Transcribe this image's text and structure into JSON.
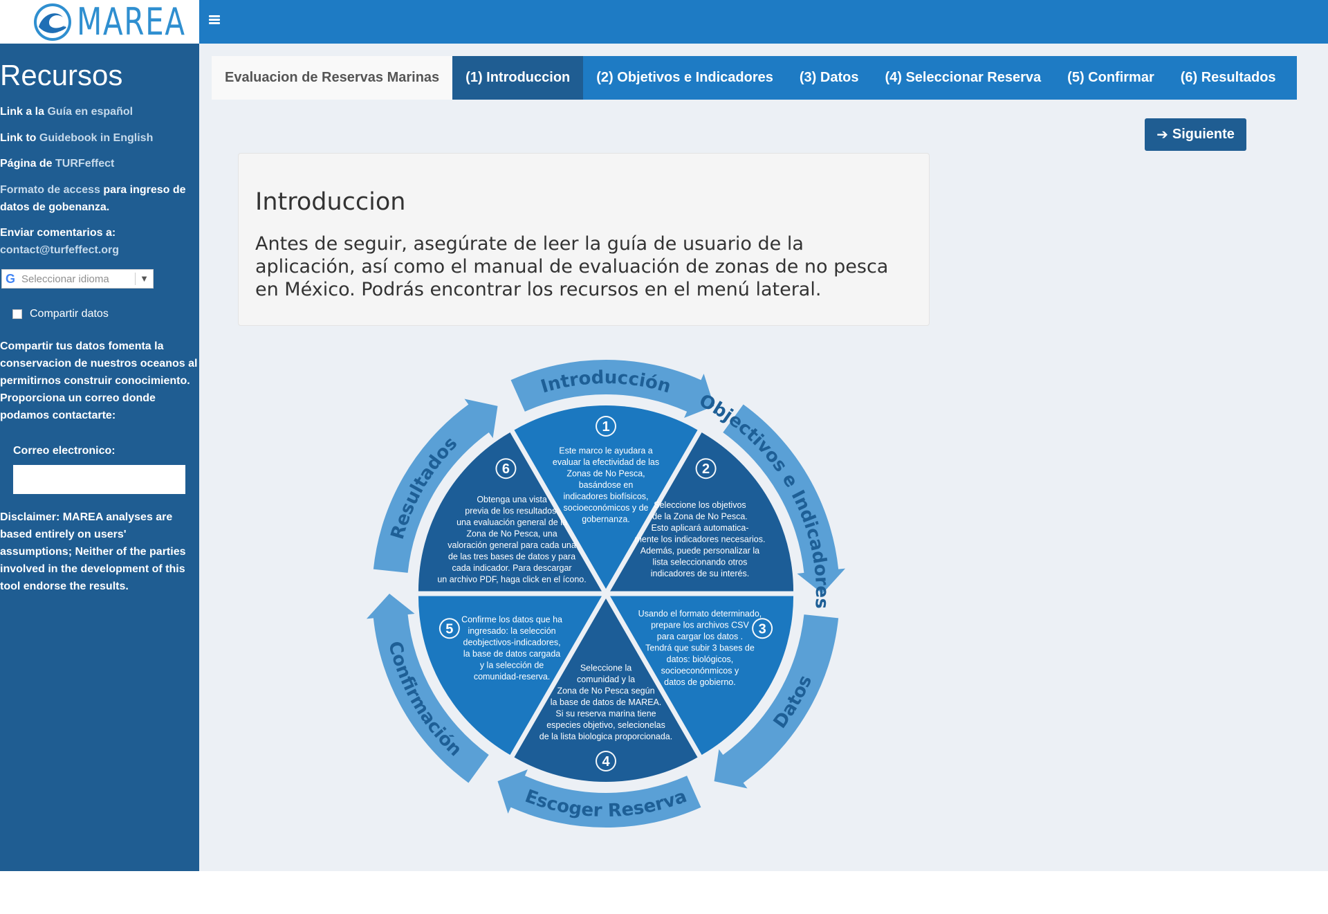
{
  "app": {
    "logo_text": "MAREA",
    "logo_icon": "wave-logo-icon",
    "menu_icon": "hamburger-icon"
  },
  "sidebar": {
    "title": "Recursos",
    "lines": [
      {
        "prefix": "Link a la ",
        "link": "Guía en español",
        "suffix": ""
      },
      {
        "prefix": "Link to ",
        "link": "Guidebook in English",
        "suffix": ""
      },
      {
        "prefix": "Página de ",
        "link": "TURFeffect",
        "suffix": ""
      }
    ],
    "format_link": "Formato de access",
    "format_suffix": " para ingreso de datos de gobenanza.",
    "comments_label": "Enviar comentarios a:",
    "comments_email": "contact@turfeffect.org",
    "translate_placeholder": "Seleccionar idioma",
    "translate_caret": "▼",
    "share_label": "Compartir datos",
    "share_text": "Compartir tus datos fomenta la conservacion de nuestros oceanos al permitirnos construir conocimiento. Proporciona un correo donde podamos contactarte:",
    "email_label": "Correo electronico:",
    "email_value": "",
    "disclaimer": "Disclaimer: MAREA analyses are based entirely on users' assumptions; Neither of the parties involved in the development of this tool endorse the results."
  },
  "tabs": {
    "brand": "Evaluacion de Reservas Marinas",
    "items": [
      {
        "label": "(1) Introduccion",
        "active": true
      },
      {
        "label": "(2) Objetivos e Indicadores",
        "active": false
      },
      {
        "label": "(3) Datos",
        "active": false
      },
      {
        "label": "(4) Seleccionar Reserva",
        "active": false
      },
      {
        "label": "(5) Confirmar",
        "active": false
      },
      {
        "label": "(6) Resultados",
        "active": false
      }
    ]
  },
  "main": {
    "next_label": "Siguiente",
    "intro_title": "Introduccion",
    "intro_text": "Antes de seguir, asegúrate de leer la guía de usuario de la aplicación, así como el manual de evaluación de zonas de no pesca en México. Podrás encontrar los recursos en el menú lateral."
  },
  "diagram": {
    "ring_labels": [
      "Introducción",
      "Objectivos e Indicadores",
      "Datos",
      "Escoger Reserva",
      "Confirmación",
      "Resultados"
    ],
    "segments": [
      {
        "num": "1",
        "lines": [
          "Este marco le ayudara a",
          "evaluar la efectividad de las",
          "Zonas de No Pesca,",
          "basándose en",
          "indicadores biofísicos,",
          "socioeconómicos y de",
          "gobernanza."
        ]
      },
      {
        "num": "2",
        "lines": [
          "Seleccione los objetivos",
          "de la Zona de No Pesca.",
          "Esto aplicará automatica-",
          "mente los indicadores necesarios.",
          "Además, puede personalizar la",
          "lista seleccionando otros",
          "indicadores de su interés."
        ]
      },
      {
        "num": "3",
        "lines": [
          "Usando el formato determinado,",
          "prepare los archivos CSV",
          "para cargar  los datos .",
          "Tendrá que subir 3 bases de",
          "datos: biológicos,",
          "socioeconónmicos y",
          "datos de gobierno."
        ]
      },
      {
        "num": "4",
        "lines": [
          "Seleccione la",
          "comunidad y la",
          "Zona de No Pesca según",
          "la base de datos de MAREA.",
          "Si su reserva marina tiene",
          "especies objetivo, selecionelas",
          "de la lista biologica proporcionada."
        ]
      },
      {
        "num": "5",
        "lines": [
          "Confirme los datos que ha",
          "ingresado: la selección",
          "deobjectivos-indicadores,",
          "la base de datos cargada",
          "y la selección de",
          "comunidad-reserva."
        ]
      },
      {
        "num": "6",
        "lines": [
          "Obtenga una vista",
          "previa de los resultados:",
          "una evaluación general de la",
          "Zona de No Pesca, una",
          "valoración general para cada una",
          "de las tres bases de datos y para",
          "cada indicador. Para descargar",
          "un archivo PDF, haga click en el ícono."
        ]
      }
    ],
    "colors": {
      "seg1": "#1b78c0",
      "seg2": "#1c5d97",
      "seg3": "#1b78c0",
      "seg4": "#1c5d97",
      "seg5": "#1b78c0",
      "seg6": "#1c5d97",
      "ring": "#5aa0d6",
      "ring_text": "#1e5f96"
    }
  }
}
